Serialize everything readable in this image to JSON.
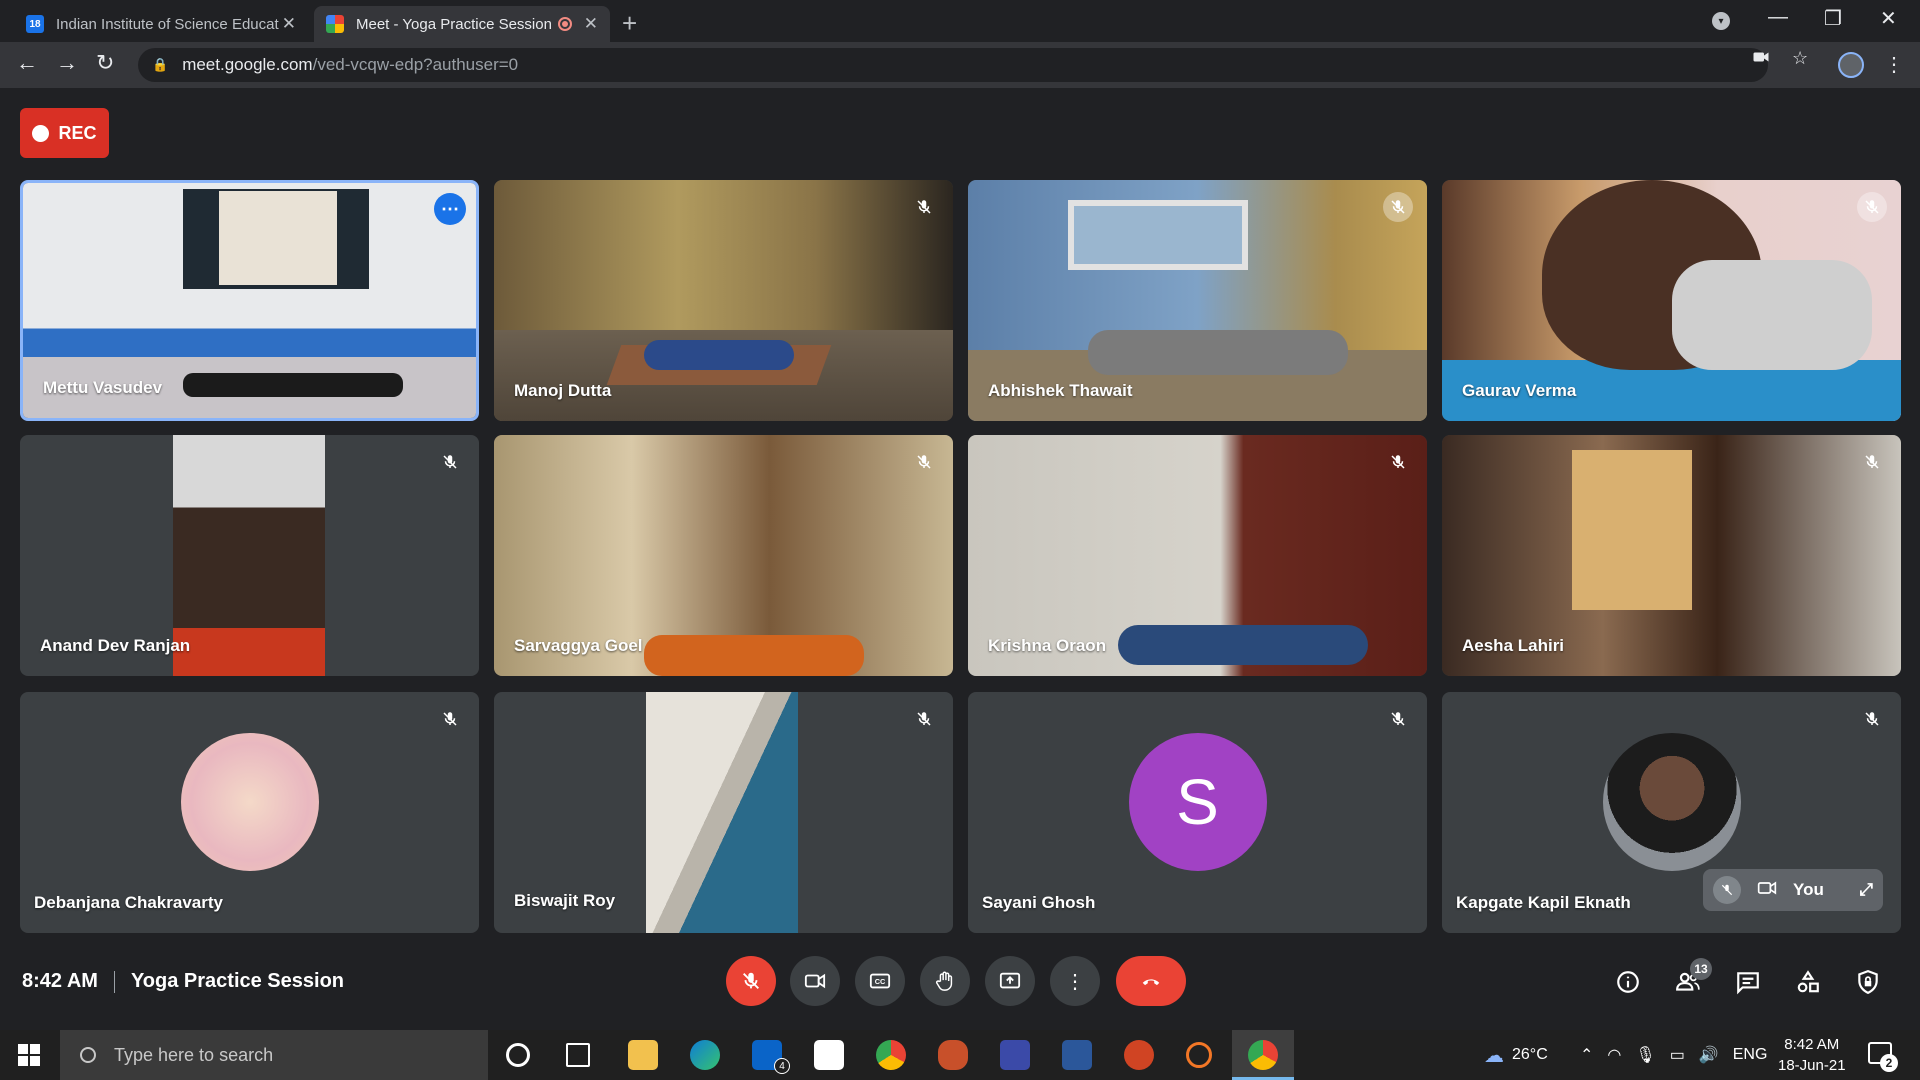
{
  "browser": {
    "tabs": [
      {
        "title": "Indian Institute of Science Educat",
        "favicon_text": "18"
      },
      {
        "title": "Meet - Yoga Practice Session"
      }
    ],
    "url_host": "meet.google.com",
    "url_path": "/ved-vcqw-edp?authuser=0"
  },
  "meet": {
    "rec_label": "REC",
    "participants": [
      {
        "name": "Mettu Vasudev"
      },
      {
        "name": "Manoj Dutta"
      },
      {
        "name": "Abhishek Thawait"
      },
      {
        "name": "Gaurav Verma"
      },
      {
        "name": "Anand Dev Ranjan"
      },
      {
        "name": "Sarvaggya Goel"
      },
      {
        "name": "Krishna Oraon"
      },
      {
        "name": "Aesha Lahiri"
      },
      {
        "name": "Debanjana Chakravarty"
      },
      {
        "name": "Biswajit Roy"
      },
      {
        "name": "Sayani Ghosh",
        "initial": "S"
      },
      {
        "name": "Kapgate Kapil Eknath"
      }
    ],
    "self_label": "You",
    "time": "8:42 AM",
    "meeting_title": "Yoga Practice Session",
    "participant_count": "13",
    "colors": {
      "accent": "#8ab4f8",
      "danger": "#ea4335",
      "avatar_purple": "#a142c4"
    }
  },
  "taskbar": {
    "search_placeholder": "Type here to search",
    "mail_badge": "4",
    "weather": "26°C",
    "lang": "ENG",
    "clock_time": "8:42 AM",
    "clock_date": "18-Jun-21",
    "notification_count": "2"
  }
}
